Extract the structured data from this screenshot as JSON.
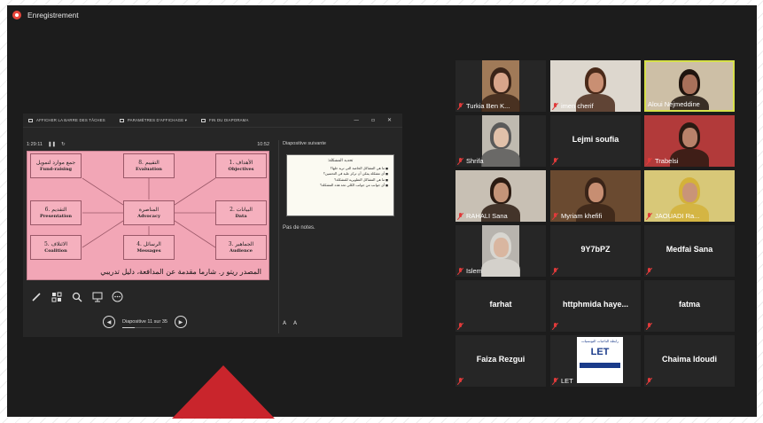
{
  "recording": {
    "label": "Enregistrement",
    "color": "#e8463b"
  },
  "presenter": {
    "toolbar": [
      {
        "label": "AFFICHER LA BARRE DES TÂCHES",
        "icon": "taskbar-icon"
      },
      {
        "label": "PARAMÈTRES D'AFFICHAGE ▾",
        "icon": "display-settings-icon"
      },
      {
        "label": "FIN DU DIAPORAMA",
        "icon": "end-show-icon"
      }
    ],
    "elapsed": "1:29:11",
    "clock": "10:52",
    "next_slide_label": "Diapositive suivante",
    "no_notes": "Pas de notes.",
    "slide_counter": "Diapositive 11 sur 35",
    "slide_progress": 0.31,
    "slide": {
      "center": {
        "ar": "المناصرة",
        "en": "Advocacy"
      },
      "boxes": [
        {
          "id": "fund",
          "ar": "جمع موارد لتمويل",
          "en": "Fund-raising"
        },
        {
          "id": "evaluation",
          "ar": "8. التقييم",
          "en": "Evaluation"
        },
        {
          "id": "objectives",
          "ar": "1. الأهداف",
          "en": "Objectives"
        },
        {
          "id": "presentation",
          "ar": "6. التقديم",
          "en": "Presentation"
        },
        {
          "id": "data",
          "ar": "2. البيانات",
          "en": "Data"
        },
        {
          "id": "coalition",
          "ar": "5. الائتلاف",
          "en": "Coalition"
        },
        {
          "id": "messages",
          "ar": "4. الرسائل",
          "en": "Messages"
        },
        {
          "id": "audience",
          "ar": "3. الجماهير",
          "en": "Audience"
        }
      ],
      "source": "المصدر  ريتو ر. شارما مقدمة عن المدافعة، دليل تدريبي"
    },
    "next_slide": {
      "title": "تحديد المشكلة:",
      "items": [
        "ما هي المشاكل الخاصة التي تريد حلها؟",
        "أي مشكلة يمكن أن تركز عليه في التحسين؟",
        "ما هي المشاكل التطويرية للمشكلة؟",
        "أي جوانب من جوانب الكلي تحد هذه المشكلة؟"
      ]
    }
  },
  "participants": [
    {
      "name": "Turkia Ben K...",
      "video": true,
      "muted": true,
      "skin": "#d8a58a",
      "hair": "#3a2418",
      "bg": "#a07a58",
      "active": false
    },
    {
      "name": "imen cherif",
      "video": true,
      "muted": true,
      "skin": "#c98f73",
      "hair": "#4a2a1a",
      "bg": "#ddd7ce",
      "active": false
    },
    {
      "name": "Aloui Nejmeddine",
      "video": true,
      "muted": false,
      "skin": "#a8705a",
      "hair": "#1f140e",
      "bg": "#cdbfa6",
      "active": true
    },
    {
      "name": "Shrifa",
      "video": true,
      "muted": true,
      "skin": "#e1c1aa",
      "hair": "#5a5a5a",
      "bg": "#bfbab0",
      "active": false
    },
    {
      "name": "Lejmi soufia",
      "video": false,
      "muted": true,
      "active": false
    },
    {
      "name": "Trabelsi",
      "video": true,
      "muted": true,
      "skin": "#b9826a",
      "hair": "#2a1a12",
      "bg": "#b23a3a",
      "active": false
    },
    {
      "name": "RAHALI Sana",
      "video": true,
      "muted": true,
      "skin": "#c49478",
      "hair": "#2b1b12",
      "bg": "#c8c0b4",
      "active": false
    },
    {
      "name": "Myriam khefifi",
      "video": true,
      "muted": true,
      "skin": "#c78e72",
      "hair": "#3a2418",
      "bg": "#6a4a30",
      "active": false
    },
    {
      "name": "JAOUADI Ra...",
      "video": true,
      "muted": true,
      "skin": "#c99478",
      "hair": "#d4b23a",
      "bg": "#d8c878",
      "active": false
    },
    {
      "name": "Islem",
      "video": true,
      "muted": true,
      "skin": "#d9b6a0",
      "hair": "#d8d6d0",
      "bg": "#b8b4ae",
      "active": false
    },
    {
      "name": "9Y7bPZ",
      "video": false,
      "muted": true,
      "active": false
    },
    {
      "name": "Medfai Sana",
      "video": false,
      "muted": true,
      "active": false
    },
    {
      "name": "farhat",
      "video": false,
      "muted": true,
      "active": false
    },
    {
      "name": "httphmida  haye...",
      "video": false,
      "muted": true,
      "active": false
    },
    {
      "name": "fatma",
      "video": false,
      "muted": true,
      "active": false
    },
    {
      "name": "Faiza Rezgui",
      "video": false,
      "muted": true,
      "active": false
    },
    {
      "name": "LET",
      "video": false,
      "logo": true,
      "muted": true,
      "active": false,
      "logo_text": {
        "top": "رابطة الناخبات التونسيات",
        "mark": "LET"
      }
    },
    {
      "name": "Chaima Idoudi",
      "video": false,
      "muted": true,
      "active": false
    }
  ]
}
